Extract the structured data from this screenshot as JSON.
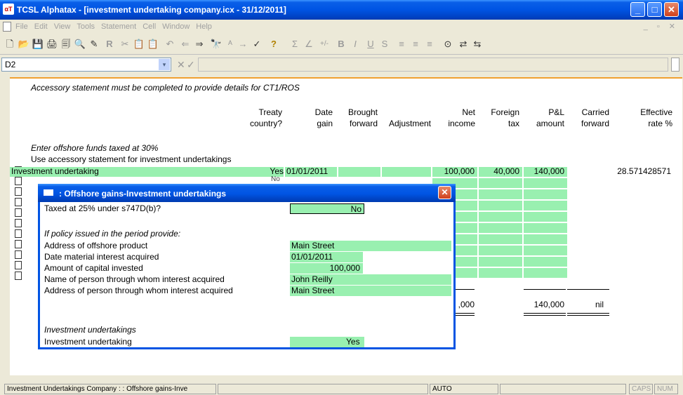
{
  "window": {
    "app_icon_text": "αT",
    "title": "TCSL Alphatax - [investment undertaking company.icx - 31/12/2011]",
    "min_glyph": "_",
    "max_glyph": "□",
    "close_glyph": "✕"
  },
  "menu": {
    "items": [
      "File",
      "Edit",
      "View",
      "Tools",
      "Statement",
      "Cell",
      "Window",
      "Help"
    ],
    "mdi_controls": "_ ▫ ✕"
  },
  "toolbar": {
    "glyphs": [
      "🗋",
      "📂",
      "💾",
      "🖨",
      "🗐",
      "🔍",
      "✎",
      "R",
      "✂",
      "📋",
      "📋",
      "↶",
      "⇐",
      "⇒",
      "🔭",
      "ᴬ",
      "→",
      "✓",
      "?",
      "Σ",
      "∠",
      "+/-",
      "B",
      "I",
      "U",
      "S",
      "≡",
      "≡",
      "≡",
      "⊙",
      "⇄",
      "⇆"
    ]
  },
  "formula": {
    "cell_ref": "D2",
    "dropdown_glyph": "▾",
    "cancel_glyph": "✕",
    "confirm_glyph": "✓"
  },
  "sheet": {
    "note": "Accessory statement must be completed to provide details for CT1/ROS",
    "columns": [
      {
        "line1": "Treaty",
        "line2": "country?"
      },
      {
        "line1": "Date",
        "line2": "gain"
      },
      {
        "line1": "Brought",
        "line2": "forward"
      },
      {
        "line1": "",
        "line2": "Adjustment"
      },
      {
        "line1": "Net",
        "line2": "income"
      },
      {
        "line1": "Foreign",
        "line2": "tax"
      },
      {
        "line1": "P&L",
        "line2": "amount"
      },
      {
        "line1": "Carried",
        "line2": "forward"
      },
      {
        "line1": "Effective",
        "line2": "rate %"
      }
    ],
    "section_note": "Enter offshore funds taxed at  30%",
    "section_note2": "Use accessory statement for investment undertakings",
    "row1": {
      "label": "Investment undertaking",
      "treaty": "Yes",
      "date_gain": "01/01/2011",
      "net_income": "100,000",
      "foreign_tax": "40,000",
      "pl_amount": "140,000",
      "effective_rate": "28.571428571"
    },
    "row2_partial": "No",
    "totals": {
      "net_income": ",000",
      "pl_amount": "140,000",
      "carried_forward": "nil"
    }
  },
  "dialog": {
    "title": ": Offshore gains-Investment undertakings",
    "close_glyph": "✕",
    "taxed_label": "Taxed at 25% under s747D(b)?",
    "taxed_value": "No",
    "policy_note": "If policy issued in the period provide:",
    "fields": [
      {
        "label": "Address of offshore product",
        "value": "Main Street"
      },
      {
        "label": "Date material interest acquired",
        "value": "01/01/2011"
      },
      {
        "label": "Amount of capital invested",
        "value": "100,000"
      },
      {
        "label": "Name of person through whom interest acquired",
        "value": "John Reilly"
      },
      {
        "label": "Address of person through whom interest acquired",
        "value": "Main Street"
      }
    ],
    "section_heading": "Investment undertakings",
    "iu_label": "Investment undertaking",
    "iu_value": "Yes"
  },
  "status": {
    "left": "Investment Undertakings Company  :  : Offshore gains-Inve",
    "mode": "AUTO",
    "caps": "CAPS",
    "num": "NUM"
  }
}
